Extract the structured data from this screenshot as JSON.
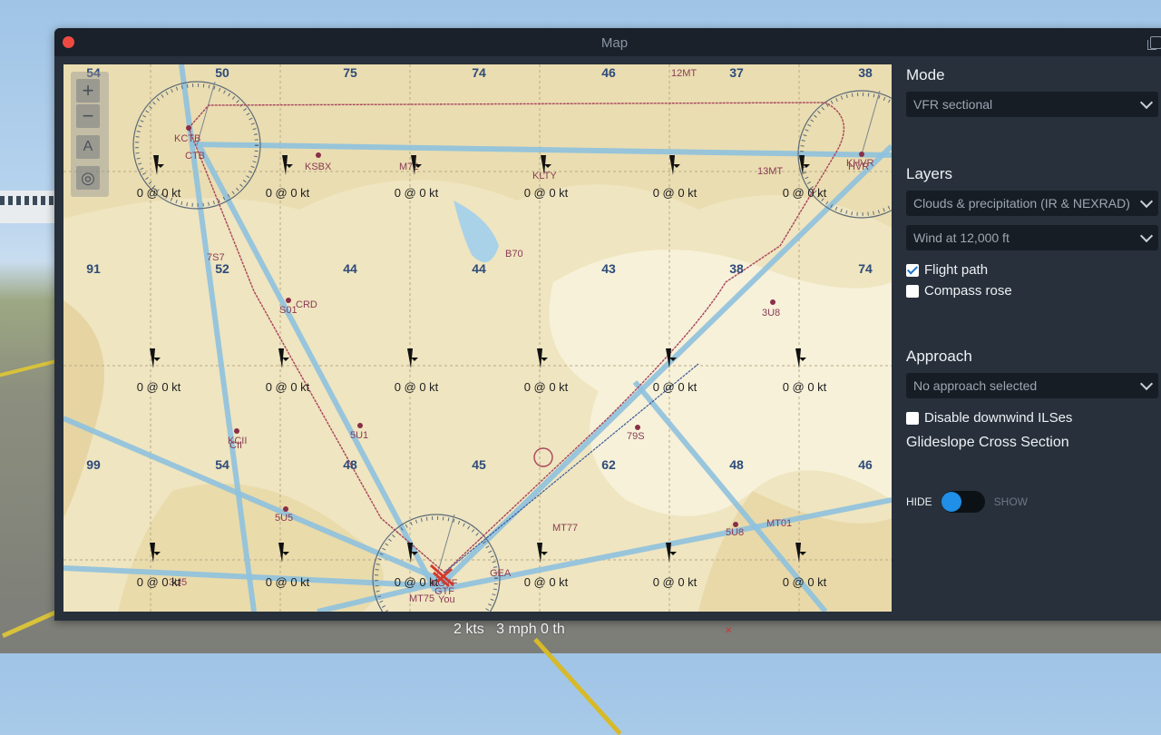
{
  "window": {
    "title": "Map"
  },
  "map": {
    "grid_numbers": [
      {
        "t": "54",
        "c": 0,
        "r": 0
      },
      {
        "t": "50",
        "c": 1,
        "r": 0
      },
      {
        "t": "75",
        "c": 2,
        "r": 0
      },
      {
        "t": "74",
        "c": 3,
        "r": 0
      },
      {
        "t": "46",
        "c": 4,
        "r": 0
      },
      {
        "t": "37",
        "c": 5,
        "r": 0
      },
      {
        "t": "38",
        "c": 6,
        "r": 0
      },
      {
        "t": "91",
        "c": 0,
        "r": 1
      },
      {
        "t": "52",
        "c": 1,
        "r": 1
      },
      {
        "t": "44",
        "c": 2,
        "r": 1
      },
      {
        "t": "44",
        "c": 3,
        "r": 1
      },
      {
        "t": "43",
        "c": 4,
        "r": 1
      },
      {
        "t": "38",
        "c": 5,
        "r": 1
      },
      {
        "t": "74",
        "c": 6,
        "r": 1
      },
      {
        "t": "99",
        "c": 0,
        "r": 2
      },
      {
        "t": "54",
        "c": 1,
        "r": 2
      },
      {
        "t": "48",
        "c": 2,
        "r": 2
      },
      {
        "t": "45",
        "c": 3,
        "r": 2
      },
      {
        "t": "62",
        "c": 4,
        "r": 2
      },
      {
        "t": "48",
        "c": 5,
        "r": 2
      },
      {
        "t": "46",
        "c": 6,
        "r": 2
      }
    ],
    "airports": [
      "KCTB",
      "CTB",
      "KSBX",
      "M72",
      "KLTY",
      "13MT",
      "KHVR",
      "HVR",
      "7S7",
      "S01",
      "CRD",
      "B70",
      "3U8",
      "KCII",
      "CII",
      "5U1",
      "79S",
      "5U5",
      "MT77",
      "MT01",
      "5U8",
      "KGTF",
      "GTF",
      "MT75",
      "You",
      "GEA",
      "3U5",
      "12MT"
    ],
    "wind_label": "0 @ 0 kt"
  },
  "controls": {
    "zoom_in": "+",
    "zoom_out": "−",
    "north_up": "A",
    "center": "◎"
  },
  "panel": {
    "mode_heading": "Mode",
    "mode_value": "VFR sectional",
    "layers_heading": "Layers",
    "layer1_value": "Clouds & precipitation (IR & NEXRAD)",
    "layer2_value": "Wind at 12,000 ft",
    "flight_path_label": "Flight path",
    "flight_path_checked": true,
    "compass_rose_label": "Compass rose",
    "compass_rose_checked": false,
    "approach_heading": "Approach",
    "approach_value": "No approach selected",
    "disable_ils_label": "Disable downwind ILSes",
    "disable_ils_checked": false,
    "glideslope_heading": "Glideslope Cross Section",
    "toggle_hide": "HIDE",
    "toggle_show": "SHOW"
  },
  "readout": {
    "wind": "2 kts   3 mph 0 th"
  },
  "colors": {
    "accent": "#1f8fe8",
    "close": "#ef4a42",
    "panel_bg": "#27303b"
  }
}
